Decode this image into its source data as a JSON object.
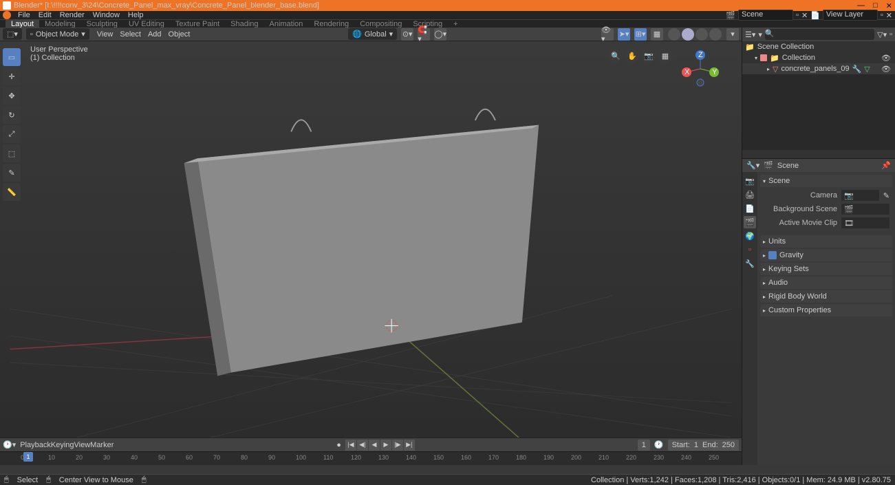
{
  "title": "Blender* [I:\\!!!!conv_3\\24\\Concrete_Panel_max_vray\\Concrete_Panel_blender_base.blend]",
  "topmenu": [
    "File",
    "Edit",
    "Render",
    "Window",
    "Help"
  ],
  "scene_field": "Scene",
  "viewlayer_field": "View Layer",
  "workspaces": {
    "items": [
      "Layout",
      "Modeling",
      "Sculpting",
      "UV Editing",
      "Texture Paint",
      "Shading",
      "Animation",
      "Rendering",
      "Compositing",
      "Scripting"
    ],
    "active": "Layout"
  },
  "viewport": {
    "mode": "Object Mode",
    "menus": [
      "View",
      "Select",
      "Add",
      "Object"
    ],
    "orient": "Global",
    "info_line1": "User Perspective",
    "info_line2": "(1) Collection"
  },
  "outliner": {
    "root": "Scene Collection",
    "collection": "Collection",
    "object": "concrete_panels_09"
  },
  "props": {
    "context": "Scene",
    "sections": {
      "scene": "Scene",
      "camera_lbl": "Camera",
      "bgscene_lbl": "Background Scene",
      "clip_lbl": "Active Movie Clip",
      "units": "Units",
      "gravity": "Gravity",
      "keying": "Keying Sets",
      "audio": "Audio",
      "rigid": "Rigid Body World",
      "custom": "Custom Properties"
    }
  },
  "timeline": {
    "menus": [
      "Playback",
      "Keying",
      "View",
      "Marker"
    ],
    "current": 1,
    "start_lbl": "Start:",
    "start": 1,
    "end_lbl": "End:",
    "end": 250,
    "ticks": [
      0,
      10,
      20,
      30,
      40,
      50,
      60,
      70,
      80,
      90,
      100,
      110,
      120,
      130,
      140,
      150,
      160,
      170,
      180,
      190,
      200,
      210,
      220,
      230,
      240,
      250
    ]
  },
  "status": {
    "left1": "Select",
    "left2": "Center View to Mouse",
    "right": "Collection | Verts:1,242 | Faces:1,208 | Tris:2,416 | Objects:0/1 | Mem: 24.9 MB | v2.80.75"
  }
}
